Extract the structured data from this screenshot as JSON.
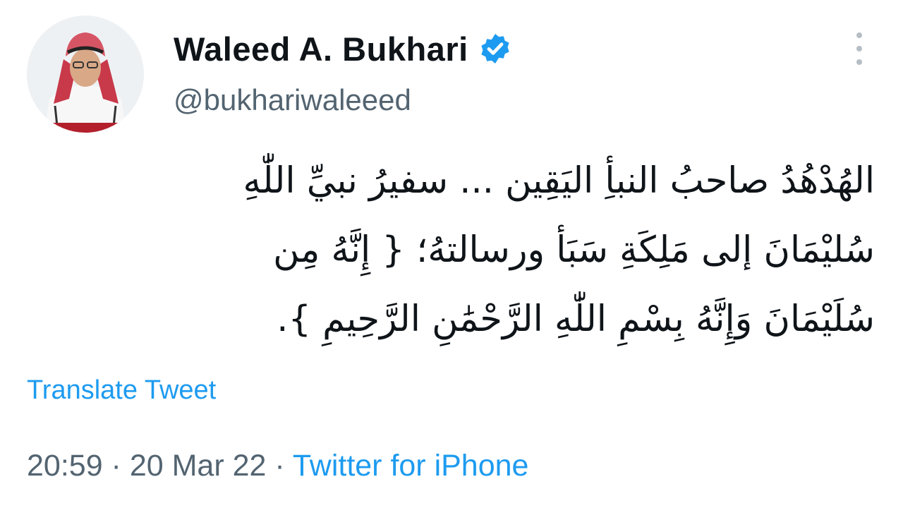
{
  "author": {
    "name": "Waleed A. Bukhari",
    "handle": "@bukhariwaleeed",
    "verified": true
  },
  "tweet": {
    "lines": [
      "الهُدْهُدُ صاحبُ النبأِ اليَقِين ... سفيرُ نبيِّ اللّٰهِ",
      "سُليْمَانَ إلى مَلِكَةِ سَبَأ ورسالتهُ؛ { إِنَّهُ مِن",
      "سُلَيْمَانَ وَإِنَّهُ بِسْمِ اللّٰهِ الرَّحْمَٰنِ الرَّحِيمِ }."
    ]
  },
  "translate_label": "Translate Tweet",
  "meta": {
    "time": "20:59",
    "separator": " · ",
    "date": "20 Mar 22",
    "source": "Twitter for iPhone"
  },
  "icons": {
    "verified": "verified-badge-icon",
    "more": "more-options-icon"
  },
  "colors": {
    "accent": "#1d9bf0",
    "text": "#0f1419",
    "secondary": "#536471"
  }
}
